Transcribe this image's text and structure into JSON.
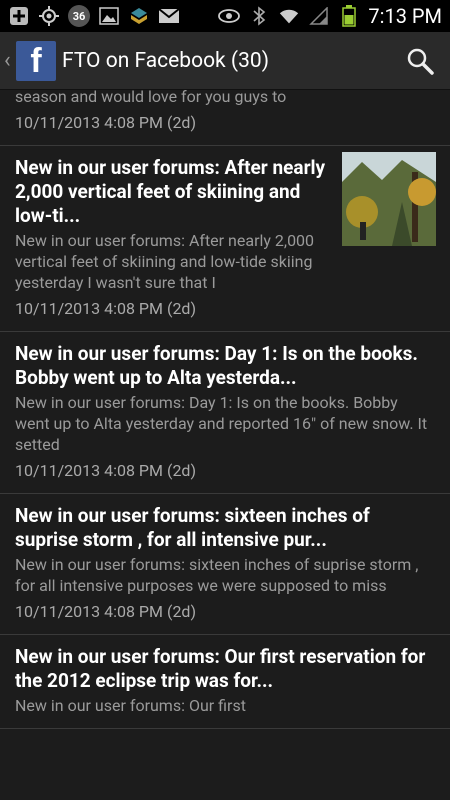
{
  "status_bar": {
    "notification_count": "36",
    "time": "7:13 PM"
  },
  "action_bar": {
    "title": "FTO on Facebook (30)",
    "logo_letter": "f"
  },
  "feed": {
    "partial_item": {
      "snippet": "season and would love for you guys to",
      "date": "10/11/2013 4:08 PM (2d)"
    },
    "items": [
      {
        "title": "New in our user forums: After nearly 2,000 vertical feet of skiining and low-ti...",
        "snippet": "New in our user forums: After nearly 2,000 vertical feet of skiining and low-tide skiing yesterday I wasn't sure that I",
        "date": "10/11/2013 4:08 PM (2d)"
      },
      {
        "title": "New in our user forums: Day 1: Is on the books. Bobby went up to Alta yesterda...",
        "snippet": "New in our user forums: Day 1: Is on the books. Bobby went up to Alta yesterday and reported 16\" of new snow. It setted",
        "date": "10/11/2013 4:08 PM (2d)"
      },
      {
        "title": "New in our user forums: sixteen inches of suprise storm , for all intensive pur...",
        "snippet": "New in our user forums: sixteen inches of suprise storm , for all intensive purposes we were supposed to miss",
        "date": "10/11/2013 4:08 PM (2d)"
      },
      {
        "title": "New in our user forums: Our first reservation for the 2012 eclipse trip was for...",
        "snippet": "New in our user forums: Our first",
        "date": ""
      }
    ]
  }
}
